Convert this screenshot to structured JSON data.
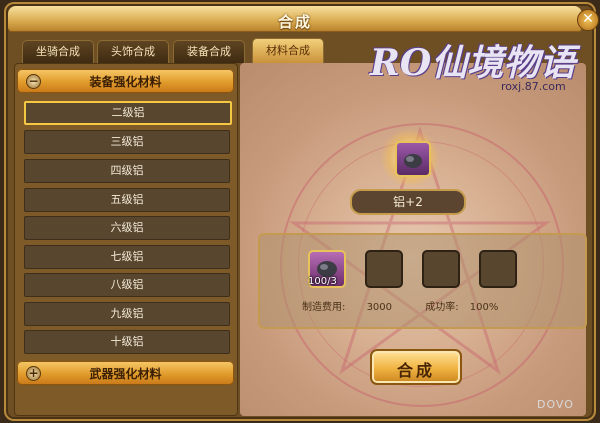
{
  "window": {
    "title": "合成",
    "close_glyph": "✕"
  },
  "tabs": [
    {
      "label": "坐骑合成"
    },
    {
      "label": "头饰合成"
    },
    {
      "label": "装备合成"
    },
    {
      "label": "材料合成"
    }
  ],
  "categories": [
    {
      "label": "装备强化材料",
      "toggle": "−"
    },
    {
      "label": "武器强化材料",
      "toggle": "+"
    }
  ],
  "items": [
    {
      "label": "二级铝"
    },
    {
      "label": "三级铝"
    },
    {
      "label": "四级铝"
    },
    {
      "label": "五级铝"
    },
    {
      "label": "六级铝"
    },
    {
      "label": "七级铝"
    },
    {
      "label": "八级铝"
    },
    {
      "label": "九级铝"
    },
    {
      "label": "十级铝"
    }
  ],
  "logo": {
    "text": "RO仙境物语",
    "site": "roxj.87.com"
  },
  "result": {
    "name": "铝+2"
  },
  "materials": [
    {
      "count": "100/3"
    }
  ],
  "cost": {
    "label": "制造费用:",
    "value": "3000"
  },
  "success": {
    "label": "成功率:",
    "value": "100%"
  },
  "craft_button": {
    "label": "合成"
  },
  "watermark": "DOVO"
}
